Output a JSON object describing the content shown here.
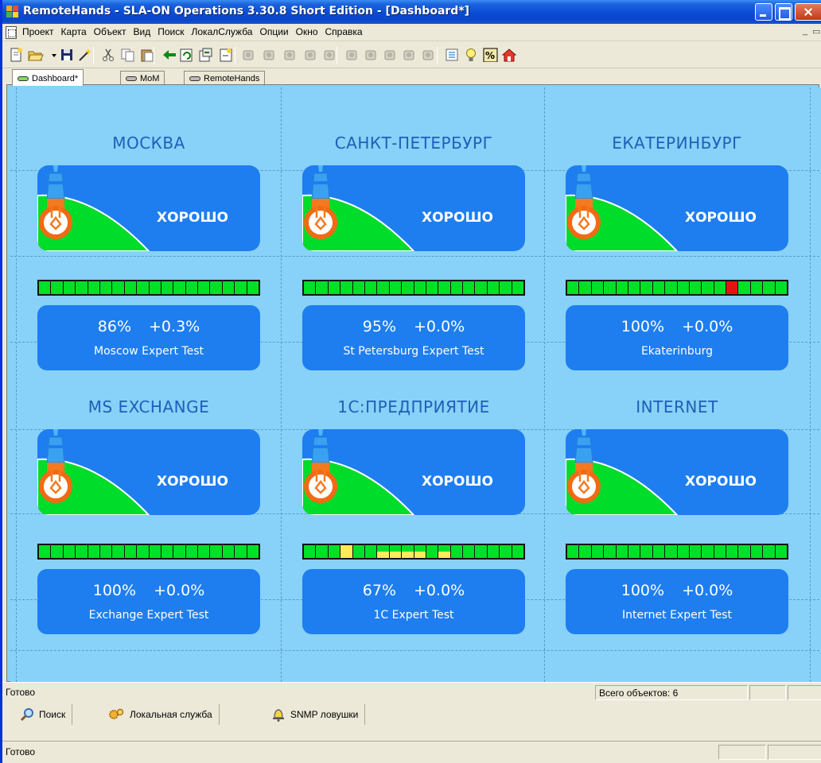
{
  "window": {
    "title": "RemoteHands - SLA-ON Operations 3.30.8 Short Edition - [Dashboard*]",
    "menu": [
      "Проект",
      "Карта",
      "Объект",
      "Вид",
      "Поиск",
      "ЛокалСлужба",
      "Опции",
      "Окно",
      "Справка"
    ]
  },
  "toolbar_icons": [
    "new-document-icon",
    "open-folder-icon",
    "dropdown-arrow-icon",
    "save-icon",
    "magic-wand-icon",
    "cut-icon",
    "copy-icon",
    "paste-icon",
    "back-arrow-icon",
    "refresh-icon",
    "export-icon",
    "import-icon",
    "tool-icon",
    "tool-icon",
    "tool-icon",
    "tool-icon",
    "tool-icon",
    "tool-icon",
    "tool-icon",
    "tool-icon",
    "tool-icon",
    "tool-icon",
    "list-icon",
    "lightbulb-icon",
    "percent-icon",
    "home-icon"
  ],
  "tabs": [
    {
      "label": "Dashboard*",
      "active": true
    },
    {
      "label": "MoM",
      "active": false
    },
    {
      "label": "RemoteHands",
      "active": false
    }
  ],
  "colors": {
    "canvas_bg": "#88d1f8",
    "card_bg": "#1e7ef0",
    "title": "#1f5fb8",
    "ok_green": "#00e02a",
    "warn_yellow": "#ffeb55",
    "err_red": "#e81212"
  },
  "panels": [
    {
      "title": "МОСКВА",
      "status": "ХОРОШО",
      "percent": "86%",
      "delta": "+0.3%",
      "label": "Moscow Expert Test",
      "segments": [
        "ok",
        "ok",
        "ok",
        "ok",
        "ok",
        "ok",
        "ok",
        "ok",
        "ok",
        "ok",
        "ok",
        "ok",
        "ok",
        "ok",
        "ok",
        "ok",
        "ok",
        "ok"
      ]
    },
    {
      "title": "САНКТ-ПЕТЕРБУРГ",
      "status": "ХОРОШО",
      "percent": "95%",
      "delta": "+0.0%",
      "label": "St Petersburg Expert Test",
      "segments": [
        "ok",
        "ok",
        "ok",
        "ok",
        "ok",
        "ok",
        "ok",
        "ok",
        "ok",
        "ok",
        "ok",
        "ok",
        "ok",
        "ok",
        "ok",
        "ok",
        "ok",
        "ok"
      ]
    },
    {
      "title": "ЕКАТЕРИНБУРГ",
      "status": "ХОРОШО",
      "percent": "100%",
      "delta": "+0.0%",
      "label": "Ekaterinburg",
      "segments": [
        "ok",
        "ok",
        "ok",
        "ok",
        "ok",
        "ok",
        "ok",
        "ok",
        "ok",
        "ok",
        "ok",
        "ok",
        "ok",
        "err",
        "ok",
        "ok",
        "ok",
        "ok"
      ]
    },
    {
      "title": "MS EXCHANGE",
      "status": "ХОРОШО",
      "percent": "100%",
      "delta": "+0.0%",
      "label": "Exchange Expert Test",
      "segments": [
        "ok",
        "ok",
        "ok",
        "ok",
        "ok",
        "ok",
        "ok",
        "ok",
        "ok",
        "ok",
        "ok",
        "ok",
        "ok",
        "ok",
        "ok",
        "ok",
        "ok",
        "ok"
      ]
    },
    {
      "title": "1С:ПРЕДПРИЯТИЕ",
      "status": "ХОРОШО",
      "percent": "67%",
      "delta": "+0.0%",
      "label": "1C  Expert Test",
      "segments": [
        "ok",
        "ok",
        "ok",
        "warn",
        "ok",
        "ok",
        "half",
        "half",
        "half",
        "half",
        "ok",
        "half",
        "ok",
        "ok",
        "ok",
        "ok",
        "ok",
        "ok"
      ]
    },
    {
      "title": "INTERNET",
      "status": "ХОРОШО",
      "percent": "100%",
      "delta": "+0.0%",
      "label": "Internet Expert Test",
      "segments": [
        "ok",
        "ok",
        "ok",
        "ok",
        "ok",
        "ok",
        "ok",
        "ok",
        "ok",
        "ok",
        "ok",
        "ok",
        "ok",
        "ok",
        "ok",
        "ok",
        "ok",
        "ok"
      ]
    }
  ],
  "statusbar": {
    "ready": "Готово",
    "objects": "Всего объектов: 6"
  },
  "bottom_tabs": [
    {
      "label": "Поиск",
      "icon": "search-icon"
    },
    {
      "label": "Локальная служба",
      "icon": "gear-icon"
    },
    {
      "label": "SNMP ловушки",
      "icon": "bell-icon"
    }
  ],
  "bottom_status": "Готово"
}
